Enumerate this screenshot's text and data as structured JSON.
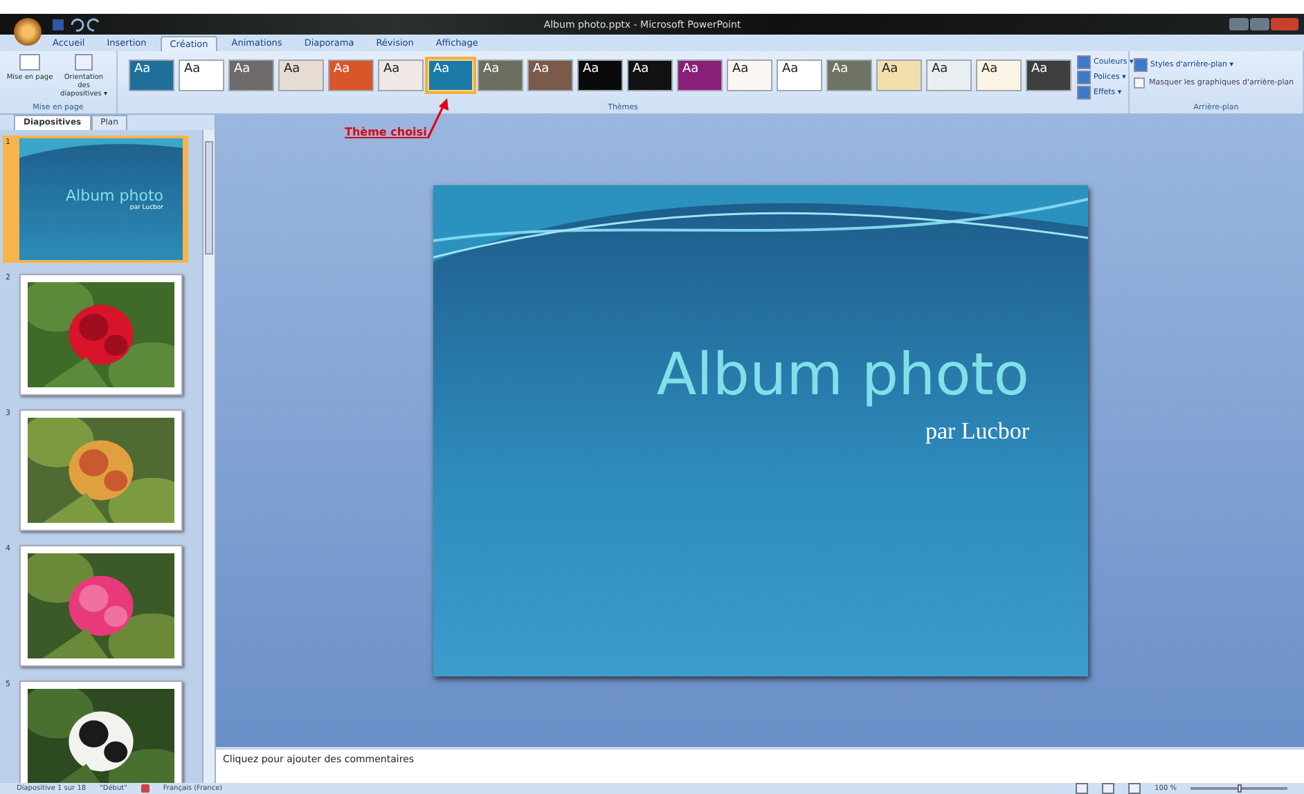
{
  "window": {
    "title": "Album photo.pptx - Microsoft PowerPoint"
  },
  "tabs": [
    {
      "label": "Accueil",
      "selected": false
    },
    {
      "label": "Insertion",
      "selected": false
    },
    {
      "label": "Création",
      "selected": true
    },
    {
      "label": "Animations",
      "selected": false
    },
    {
      "label": "Diaporama",
      "selected": false
    },
    {
      "label": "Révision",
      "selected": false
    },
    {
      "label": "Affichage",
      "selected": false
    }
  ],
  "page_setup": {
    "buttons": [
      "Mise en page",
      "Orientation des diapositives ▾"
    ],
    "group_label": "Mise en page"
  },
  "themes": {
    "items": [
      {
        "label": "Aa",
        "color": "#1f6f9a",
        "selected": false
      },
      {
        "label": "Aa",
        "color": "#ffffff",
        "selected": false
      },
      {
        "label": "Aa",
        "color": "#6e6a6a",
        "selected": false
      },
      {
        "label": "Aa",
        "color": "#e6dcd4",
        "selected": false
      },
      {
        "label": "Aa",
        "color": "#d8562a",
        "selected": false
      },
      {
        "label": "Aa",
        "color": "#efe8e4",
        "selected": false
      },
      {
        "label": "Aa",
        "color": "#1c7aa8",
        "selected": true
      },
      {
        "label": "Aa",
        "color": "#6b6e5e",
        "selected": false
      },
      {
        "label": "Aa",
        "color": "#7a5a48",
        "selected": false
      },
      {
        "label": "Aa",
        "color": "#0a0a0a",
        "selected": false
      },
      {
        "label": "Aa",
        "color": "#111111",
        "selected": false
      },
      {
        "label": "Aa",
        "color": "#8a1f7a",
        "selected": false
      },
      {
        "label": "Aa",
        "color": "#fbf6f2",
        "selected": false
      },
      {
        "label": "Aa",
        "color": "#ffffff",
        "selected": false
      },
      {
        "label": "Aa",
        "color": "#6f7462",
        "selected": false
      },
      {
        "label": "Aa",
        "color": "#f3dfae",
        "selected": false
      },
      {
        "label": "Aa",
        "color": "#e8eef2",
        "selected": false
      },
      {
        "label": "Aa",
        "color": "#fbf3e4",
        "selected": false
      },
      {
        "label": "Aa",
        "color": "#3e3e3e",
        "selected": false
      }
    ],
    "options": [
      "Couleurs ▾",
      "Polices ▾",
      "Effets ▾"
    ],
    "group_label": "Thèmes"
  },
  "background": {
    "styles_button": "Styles d'arrière-plan ▾",
    "hide_graphics": {
      "label": "Masquer les graphiques d'arrière-plan",
      "checked": false
    },
    "group_label": "Arrière-plan"
  },
  "annotation": "Thème choisi",
  "sidebar": {
    "tabs": [
      {
        "label": "Diapositives",
        "selected": true
      },
      {
        "label": "Plan",
        "selected": false
      }
    ],
    "slides": [
      {
        "number": "1",
        "kind": "title",
        "title": "Album photo",
        "subtitle": "par Lucbor",
        "selected": true
      },
      {
        "number": "2",
        "selected": false
      },
      {
        "number": "3",
        "selected": false
      },
      {
        "number": "4",
        "selected": false
      },
      {
        "number": "5",
        "selected": false
      }
    ]
  },
  "slide": {
    "title": "Album photo",
    "subtitle": "par Lucbor"
  },
  "notes": {
    "placeholder": "Cliquez pour ajouter des commentaires"
  },
  "status_bar": {
    "slide": "Diapositive 1 sur 18",
    "theme": "\"Début\"",
    "language": "Français (France)",
    "zoom": "100 %",
    "zoom_slider": {
      "level": 0.5
    }
  }
}
